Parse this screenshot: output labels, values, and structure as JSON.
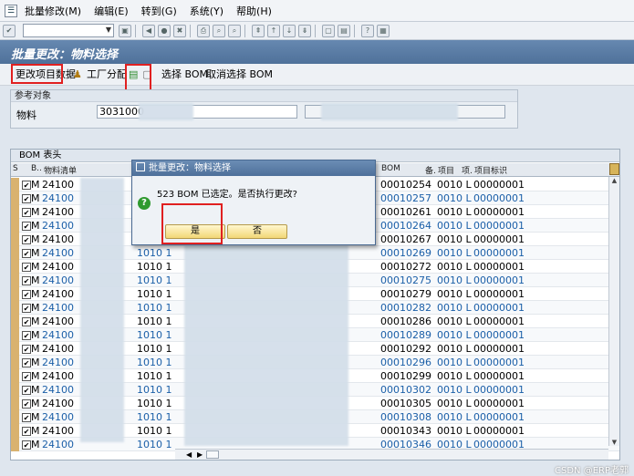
{
  "menu": [
    "批量修改(M)",
    "编辑(E)",
    "转到(G)",
    "系统(Y)",
    "帮助(H)"
  ],
  "title": "批量更改：物料选择",
  "app_toolbar": {
    "change_items": "更改项目数据",
    "plant_assign": "工厂分配",
    "select_bom": "选择 BOM",
    "deselect_bom": "取消选择 BOM"
  },
  "ref": {
    "section": "参考对象",
    "material_label": "物料",
    "material_value": "3031000"
  },
  "grid": {
    "title": "BOM 表头",
    "headers": [
      "S",
      "B..",
      "物料清单",
      "BOM",
      "备.",
      "项目",
      "项.",
      "项目标识"
    ],
    "rows": [
      {
        "b": "M",
        "mat": "24100",
        "p": "",
        "bom": "00010254",
        "item": "0010 L",
        "id": "00000001",
        "blue": false
      },
      {
        "b": "M",
        "mat": "24100",
        "p": "",
        "bom": "00010257",
        "item": "0010 L",
        "id": "00000001",
        "blue": true
      },
      {
        "b": "M",
        "mat": "24100",
        "p": "",
        "bom": "00010261",
        "item": "0010 L",
        "id": "00000001",
        "blue": false
      },
      {
        "b": "M",
        "mat": "24100",
        "p": "",
        "bom": "00010264",
        "item": "0010 L",
        "id": "00000001",
        "blue": true
      },
      {
        "b": "M",
        "mat": "24100",
        "p": "",
        "bom": "00010267",
        "item": "0010 L",
        "id": "00000001",
        "blue": false
      },
      {
        "b": "M",
        "mat": "24100",
        "p": "1010 1",
        "bom": "00010269",
        "item": "0010 L",
        "id": "00000001",
        "blue": true
      },
      {
        "b": "M",
        "mat": "24100",
        "p": "1010 1",
        "bom": "00010272",
        "item": "0010 L",
        "id": "00000001",
        "blue": false
      },
      {
        "b": "M",
        "mat": "24100",
        "p": "1010 1",
        "bom": "00010275",
        "item": "0010 L",
        "id": "00000001",
        "blue": true
      },
      {
        "b": "M",
        "mat": "24100",
        "p": "1010 1",
        "bom": "00010279",
        "item": "0010 L",
        "id": "00000001",
        "blue": false
      },
      {
        "b": "M",
        "mat": "24100",
        "p": "1010 1",
        "bom": "00010282",
        "item": "0010 L",
        "id": "00000001",
        "blue": true
      },
      {
        "b": "M",
        "mat": "24100",
        "p": "1010 1",
        "bom": "00010286",
        "item": "0010 L",
        "id": "00000001",
        "blue": false
      },
      {
        "b": "M",
        "mat": "24100",
        "p": "1010 1",
        "bom": "00010289",
        "item": "0010 L",
        "id": "00000001",
        "blue": true
      },
      {
        "b": "M",
        "mat": "24100",
        "p": "1010 1",
        "bom": "00010292",
        "item": "0010 L",
        "id": "00000001",
        "blue": false
      },
      {
        "b": "M",
        "mat": "24100",
        "p": "1010 1",
        "bom": "00010296",
        "item": "0010 L",
        "id": "00000001",
        "blue": true
      },
      {
        "b": "M",
        "mat": "24100",
        "p": "1010 1",
        "bom": "00010299",
        "item": "0010 L",
        "id": "00000001",
        "blue": false
      },
      {
        "b": "M",
        "mat": "24100",
        "p": "1010 1",
        "bom": "00010302",
        "item": "0010 L",
        "id": "00000001",
        "blue": true
      },
      {
        "b": "M",
        "mat": "24100",
        "p": "1010 1",
        "bom": "00010305",
        "item": "0010 L",
        "id": "00000001",
        "blue": false
      },
      {
        "b": "M",
        "mat": "24100",
        "p": "1010 1",
        "bom": "00010308",
        "item": "0010 L",
        "id": "00000001",
        "blue": true
      },
      {
        "b": "M",
        "mat": "24100",
        "p": "1010 1",
        "bom": "00010343",
        "item": "0010 L",
        "id": "00000001",
        "blue": false
      },
      {
        "b": "M",
        "mat": "24100",
        "p": "1010 1",
        "bom": "00010346",
        "item": "0010 L",
        "id": "00000001",
        "blue": true
      }
    ]
  },
  "dialog": {
    "title": "批量更改：物料选择",
    "message": "523 BOM 已选定。是否执行更改?",
    "yes": "是",
    "no": "否"
  },
  "watermark": "CSDN @ERP老郭"
}
